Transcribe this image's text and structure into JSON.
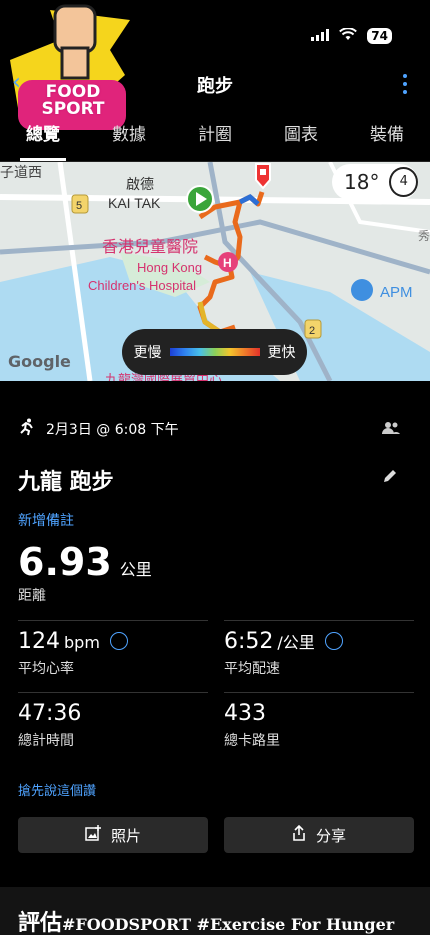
{
  "status": {
    "battery": "74"
  },
  "logo": {
    "line1": "FOOD",
    "line2": "SPORT"
  },
  "nav": {
    "back": "‹",
    "title": "跑步"
  },
  "tabs": [
    "總覽",
    "數據",
    "計圈",
    "圖表",
    "裝備"
  ],
  "map": {
    "labels": {
      "district": "啟德",
      "district_en": "KAI TAK",
      "hospital": "香港兒童醫院",
      "hospital_en_1": "Hong Kong",
      "hospital_en_2": "Children's Hospital",
      "apm": "APM",
      "road": "子道西",
      "route_5": "5",
      "route_2": "2",
      "hospital_marker": "H",
      "right_edge": "秀",
      "bottom_cut": "九龍灣國際展貿中心"
    },
    "temperature": "18°",
    "compass": "4",
    "legend": {
      "slow": "更慢",
      "fast": "更快"
    },
    "attribution": "Google"
  },
  "activity": {
    "datetime": "2月3日 @ 6:08 下午",
    "title": "九龍 跑步",
    "add_note": "新增備註",
    "distance": {
      "value": "6.93",
      "unit": "公里",
      "label": "距離"
    },
    "stats": [
      {
        "value": "124",
        "unit": "bpm",
        "label": "平均心率",
        "icon": true
      },
      {
        "value": "6:52",
        "unit": "/公里",
        "label": "平均配速",
        "icon": true
      },
      {
        "value": "47:36",
        "unit": "",
        "label": "總計時間",
        "icon": false
      },
      {
        "value": "433",
        "unit": "",
        "label": "總卡路里",
        "icon": false
      }
    ],
    "first_say": "搶先說這個讚",
    "photo_button": "照片",
    "share_button": "分享"
  },
  "rating": {
    "title": "評估",
    "hashtag": "#FOODSPORT #Exercise For Hunger"
  }
}
